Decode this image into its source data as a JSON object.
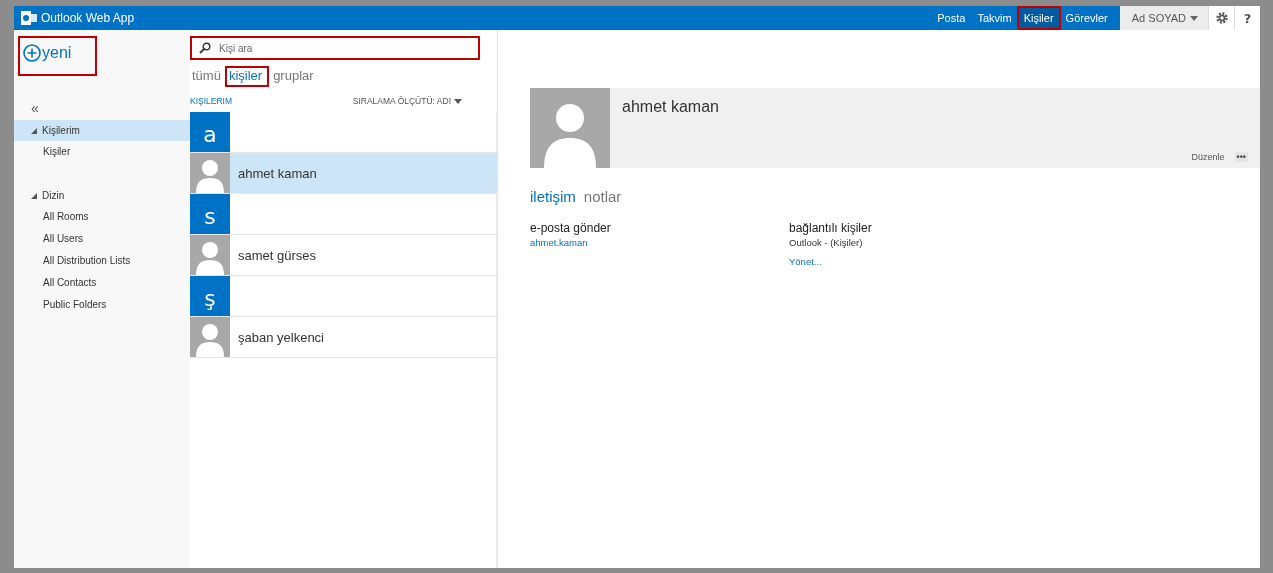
{
  "app": {
    "title": "Outlook Web App"
  },
  "nav": [
    {
      "label": "Posta",
      "selected": false,
      "highlighted": false
    },
    {
      "label": "Takvim",
      "selected": false,
      "highlighted": false
    },
    {
      "label": "Kişiler",
      "selected": true,
      "highlighted": true
    },
    {
      "label": "Görevler",
      "selected": false,
      "highlighted": false
    }
  ],
  "user": {
    "name": "Ad SOYAD"
  },
  "help": "?",
  "new_button": {
    "label": "yeni",
    "highlighted": true
  },
  "search": {
    "placeholder": "Kişi ara",
    "highlighted": true
  },
  "filters": [
    {
      "label": "tümü",
      "selected": false,
      "highlighted": false
    },
    {
      "label": "kişiler",
      "selected": true,
      "highlighted": true
    },
    {
      "label": "gruplar",
      "selected": false,
      "highlighted": false
    }
  ],
  "collapse": "«",
  "folders": [
    {
      "label": "Kişilerim",
      "expanded": true,
      "selected": true,
      "children": [
        {
          "label": "Kişiler",
          "selected": false
        }
      ]
    },
    {
      "label": "Dizin",
      "expanded": true,
      "selected": false,
      "children": [
        {
          "label": "All Rooms",
          "selected": false
        },
        {
          "label": "All Users",
          "selected": false
        },
        {
          "label": "All Distribution Lists",
          "selected": false
        },
        {
          "label": "All Contacts",
          "selected": false
        },
        {
          "label": "Public Folders",
          "selected": false
        }
      ]
    }
  ],
  "list": {
    "heading": "KIŞILERIM",
    "sort": "SIRALAMA ÖLÇÜTÜ: ADI",
    "items": [
      {
        "kind": "letter",
        "label": "a"
      },
      {
        "kind": "contact",
        "name": "ahmet kaman",
        "selected": true
      },
      {
        "kind": "letter",
        "label": "s"
      },
      {
        "kind": "contact",
        "name": "samet gürses",
        "selected": false
      },
      {
        "kind": "letter",
        "label": "ş"
      },
      {
        "kind": "contact",
        "name": "şaban yelkenci",
        "selected": false
      }
    ]
  },
  "detail": {
    "name": "ahmet kaman",
    "edit": "Düzenle",
    "more": "•••",
    "tabs": [
      {
        "label": "iletişim",
        "selected": true
      },
      {
        "label": "notlar",
        "selected": false
      }
    ],
    "sections": [
      {
        "title": "e-posta gönder",
        "lines": [
          {
            "kind": "link",
            "text": "ahmet.kaman"
          }
        ]
      },
      {
        "title": "bağlantılı kişiler",
        "lines": [
          {
            "kind": "text",
            "text": "Outlook - (Kişiler)"
          },
          {
            "kind": "link",
            "text": "Yönet..."
          }
        ]
      }
    ]
  }
}
